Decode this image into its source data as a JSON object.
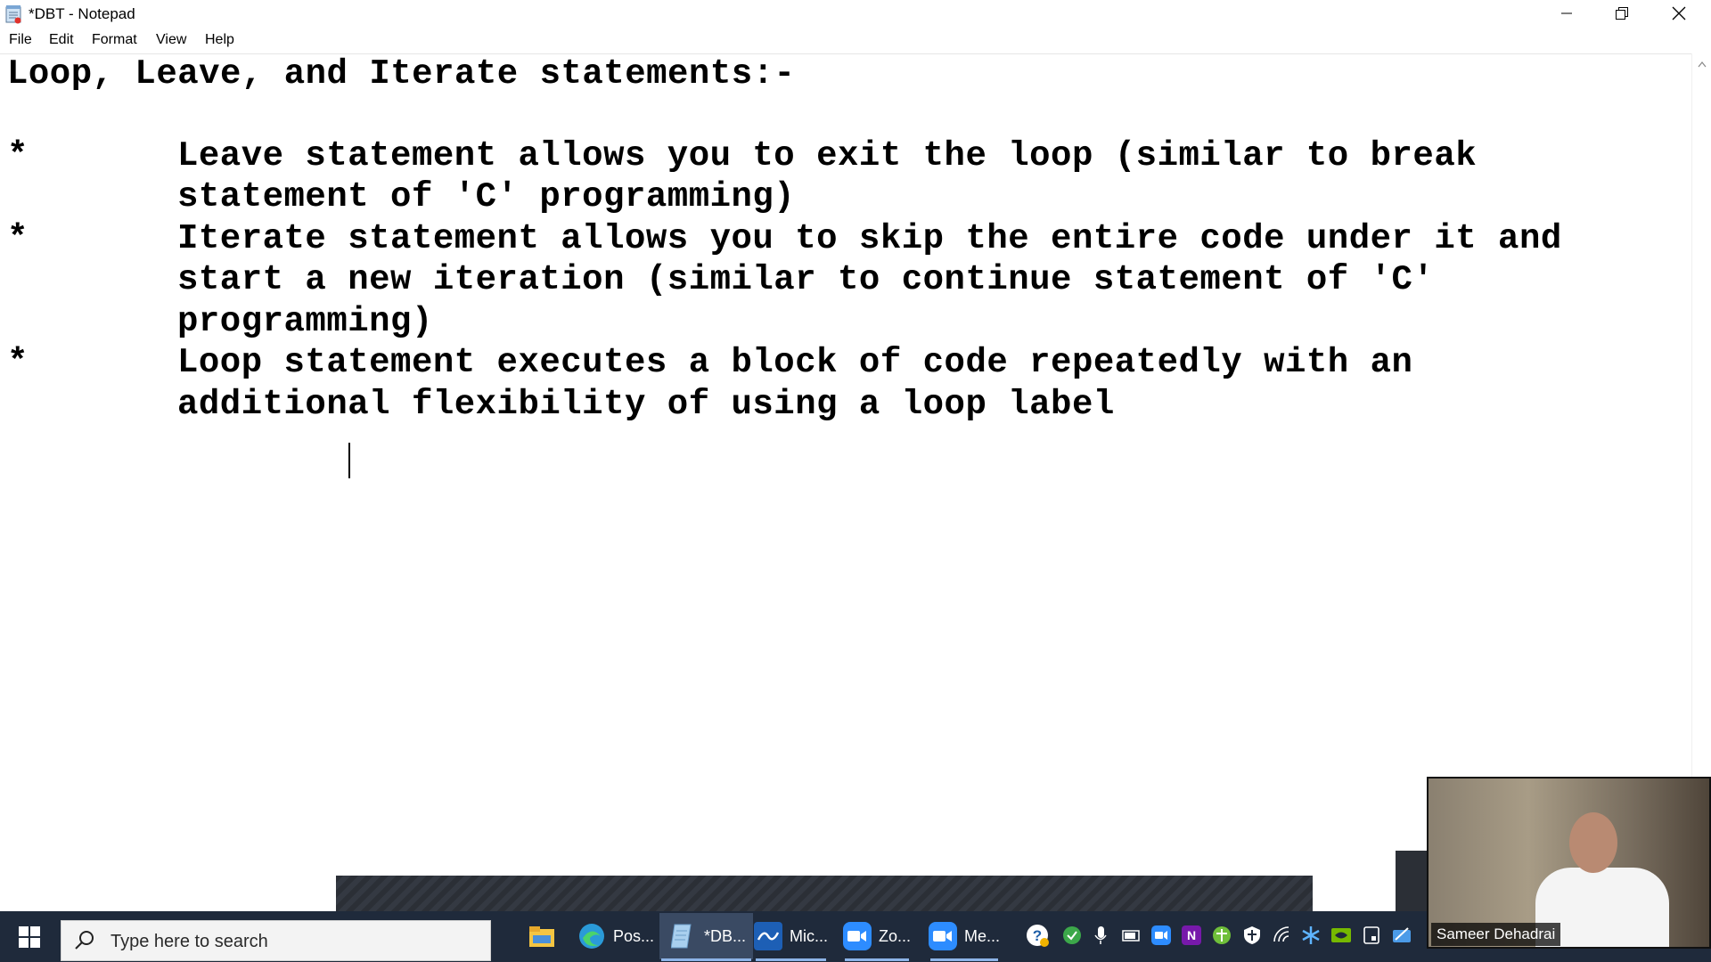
{
  "window": {
    "title": "*DBT - Notepad",
    "controls": {
      "minimize": "minimize",
      "maximize": "restore",
      "close": "close"
    }
  },
  "menu": {
    "items": [
      "File",
      "Edit",
      "Format",
      "View",
      "Help"
    ]
  },
  "document": {
    "heading": "Loop, Leave, and Iterate statements:-",
    "bullet_char": "*",
    "lines": [
      "Leave statement allows you to exit the loop (similar to break",
      "statement of 'C' programming)",
      "Iterate statement allows you to skip the entire code under it and",
      "start a new iteration (similar to continue statement of 'C'",
      "programming)",
      "Loop statement executes a block of code repeatedly with an",
      "additional flexibility of using a loop label"
    ]
  },
  "taskbar": {
    "search_placeholder": "Type here to search",
    "apps": [
      {
        "label": "",
        "icon": "file-explorer-icon"
      },
      {
        "label": "Pos...",
        "icon": "edge-icon"
      },
      {
        "label": "*DB...",
        "icon": "notepad-icon"
      },
      {
        "label": "Mic...",
        "icon": "whiteboard-icon"
      },
      {
        "label": "Zo...",
        "icon": "zoom-icon"
      },
      {
        "label": "Me...",
        "icon": "zoom-meeting-icon"
      }
    ]
  },
  "webcam": {
    "name": "Sameer Dehadrai"
  },
  "colors": {
    "taskbar": "#1f2a3b",
    "accent": "#8db4e8",
    "text": "#000000"
  }
}
